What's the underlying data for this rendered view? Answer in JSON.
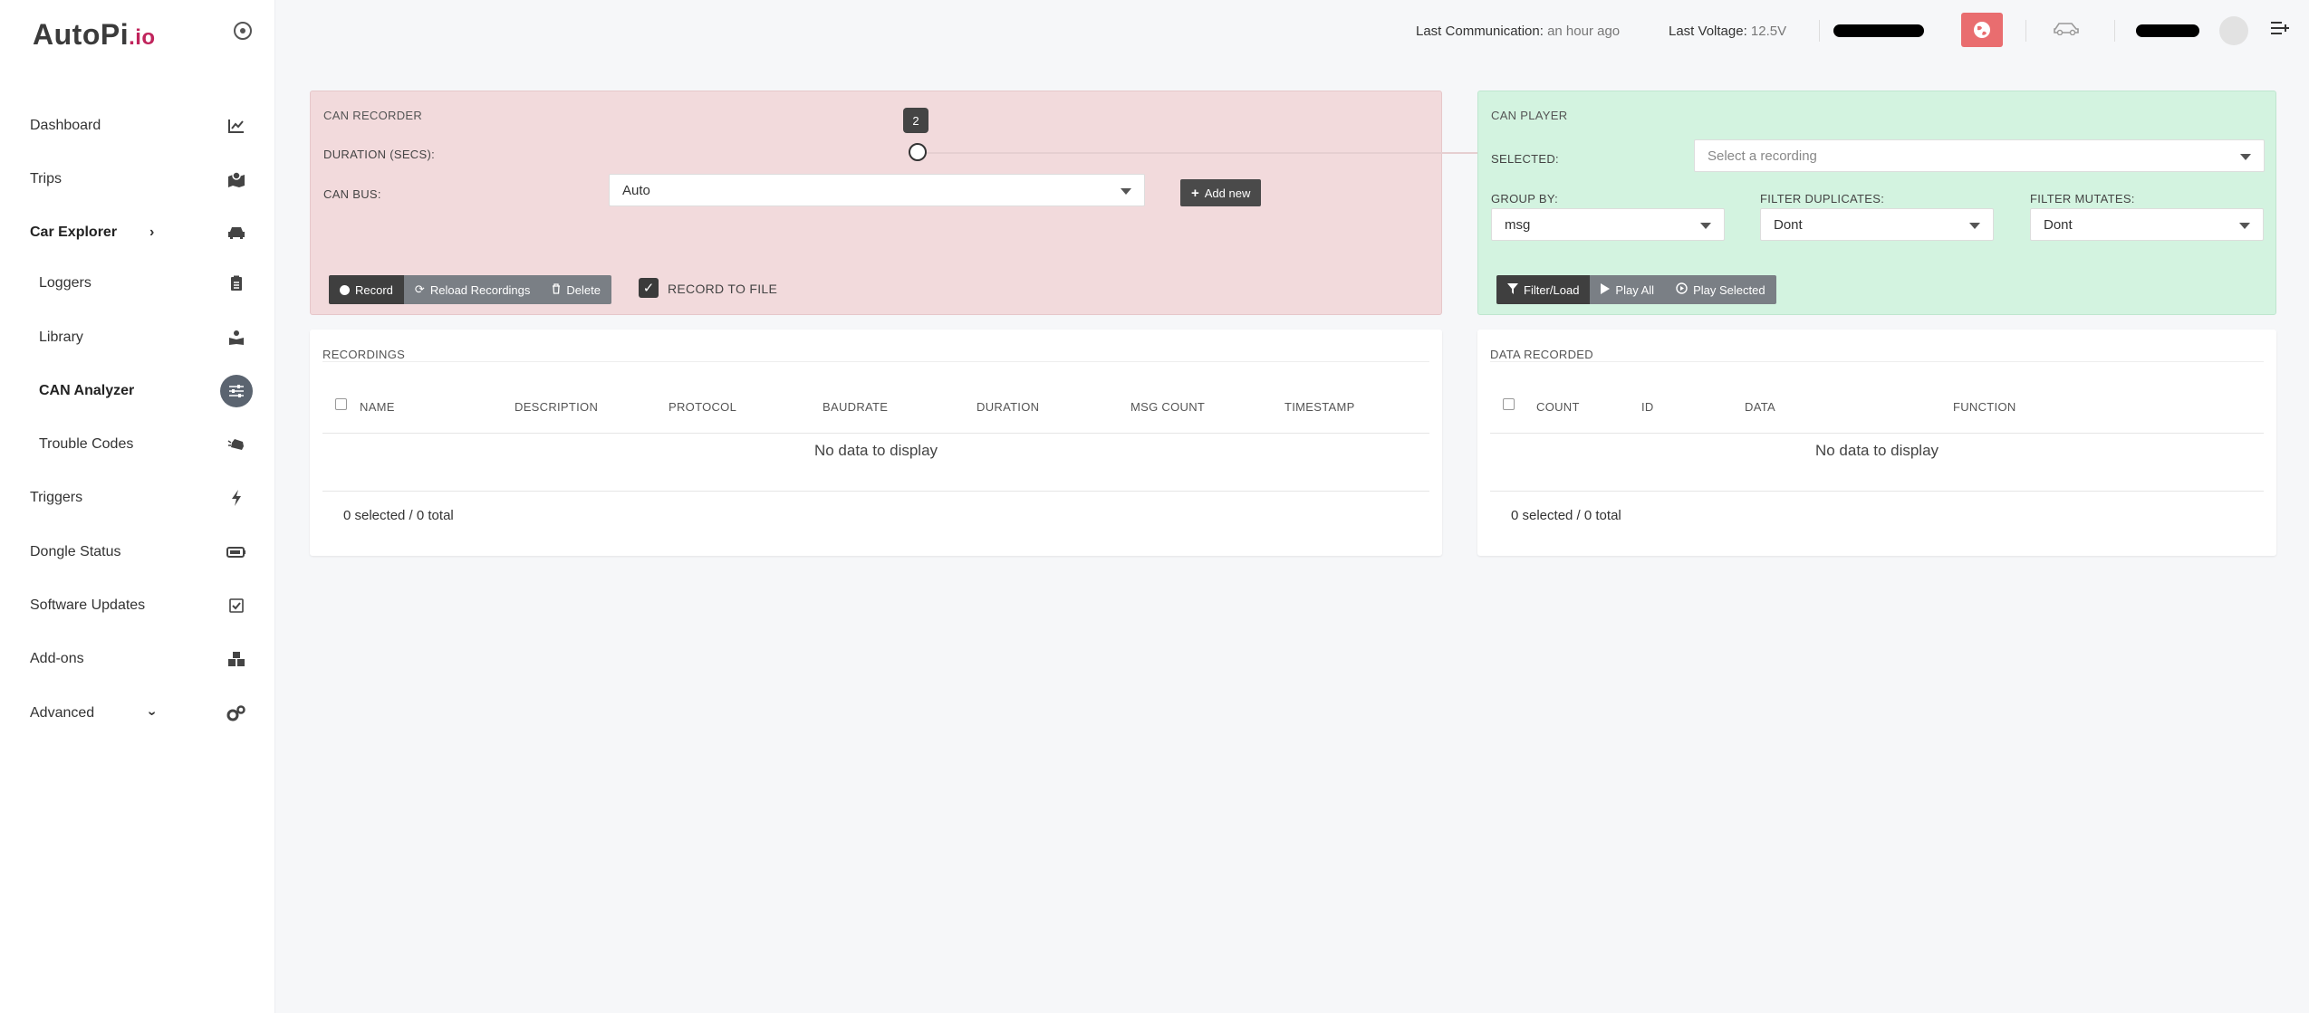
{
  "app": {
    "logo_main": "AutoPi",
    "logo_suffix": ".io"
  },
  "sidebar": {
    "items": [
      {
        "label": "Dashboard",
        "icon": "chart-line-icon"
      },
      {
        "label": "Trips",
        "icon": "map-marked-icon"
      },
      {
        "label": "Car Explorer",
        "icon": "car-icon"
      },
      {
        "label": "Loggers",
        "icon": "clipboard-icon"
      },
      {
        "label": "Library",
        "icon": "book-reader-icon"
      },
      {
        "label": "CAN Analyzer",
        "icon": "sliders-icon"
      },
      {
        "label": "Trouble Codes",
        "icon": "car-crash-icon"
      },
      {
        "label": "Triggers",
        "icon": "bolt-icon"
      },
      {
        "label": "Dongle Status",
        "icon": "battery-icon"
      },
      {
        "label": "Software Updates",
        "icon": "check-square-icon"
      },
      {
        "label": "Add-ons",
        "icon": "cubes-icon"
      },
      {
        "label": "Advanced",
        "icon": "cogs-icon"
      }
    ]
  },
  "topbar": {
    "last_comm_label": "Last Communication:",
    "last_comm_value": "an hour ago",
    "last_voltage_label": "Last Voltage:",
    "last_voltage_value": "12.5V"
  },
  "recorder": {
    "title": "CAN RECORDER",
    "duration_label": "DURATION (SECS):",
    "duration_value": "2",
    "canbus_label": "CAN BUS:",
    "canbus_value": "Auto",
    "add_new_label": "Add new",
    "record_label": "Record",
    "reload_label": "Reload Recordings",
    "delete_label": "Delete",
    "record_to_file_label": "RECORD TO FILE",
    "record_to_file_checked": true
  },
  "player": {
    "title": "CAN PLAYER",
    "selected_label": "SELECTED:",
    "selected_placeholder": "Select a recording",
    "group_by_label": "GROUP BY:",
    "group_by_value": "msg",
    "filter_dup_label": "FILTER DUPLICATES:",
    "filter_dup_value": "Dont",
    "filter_mut_label": "FILTER MUTATES:",
    "filter_mut_value": "Dont",
    "filter_load_label": "Filter/Load",
    "play_all_label": "Play All",
    "play_selected_label": "Play Selected"
  },
  "recordings": {
    "title": "RECORDINGS",
    "columns": [
      "NAME",
      "DESCRIPTION",
      "PROTOCOL",
      "BAUDRATE",
      "DURATION",
      "MSG COUNT",
      "TIMESTAMP"
    ],
    "empty_text": "No data to display",
    "footer": "0 selected / 0 total"
  },
  "data_recorded": {
    "title": "DATA RECORDED",
    "columns": [
      "COUNT",
      "ID",
      "DATA",
      "FUNCTION"
    ],
    "empty_text": "No data to display",
    "footer": "0 selected / 0 total"
  },
  "colors": {
    "recorder_bg": "#f2dadc",
    "player_bg": "#d3f3e0",
    "globe_button": "#e96d6f",
    "logo_accent": "#c0245c"
  }
}
